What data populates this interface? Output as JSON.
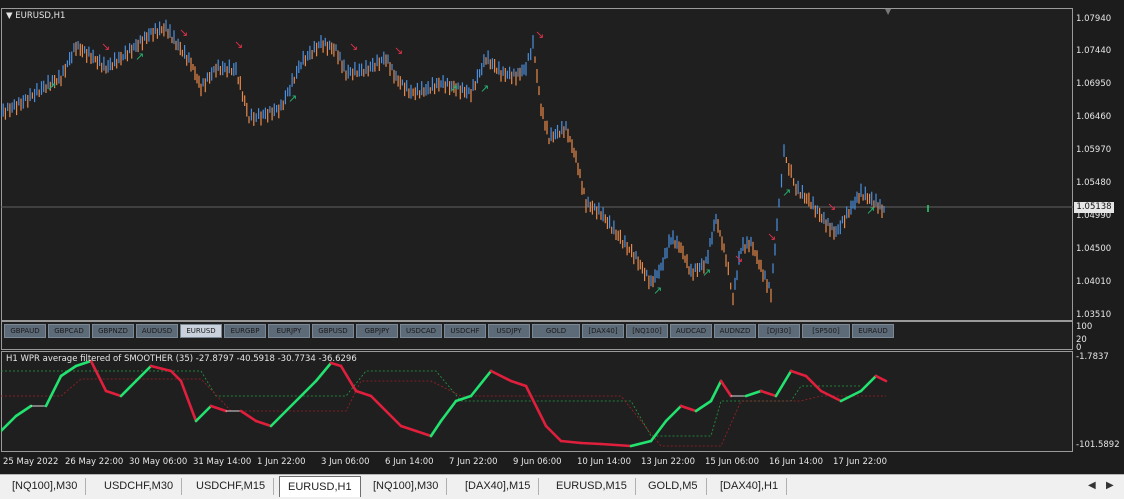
{
  "chart": {
    "title": "EURUSD,H1",
    "price_axis": [
      "1.07940",
      "1.07440",
      "1.06950",
      "1.06460",
      "1.05970",
      "1.05480",
      "1.04990",
      "1.04500",
      "1.04010",
      "1.03510"
    ],
    "current_price": "1.05138",
    "colors": {
      "bull": "#4a8fe0",
      "bear": "#e8894a",
      "arrow_up": "#26b070",
      "arrow_down": "#e0304a",
      "wpr_up": "#22e36f",
      "wpr_down": "#e01f3d"
    }
  },
  "symbols": [
    "GBPAUD",
    "GBPCAD",
    "GBPNZD",
    "AUDUSD",
    "EURUSD",
    "EURGBP",
    "EURJPY",
    "GBPUSD",
    "GBPJPY",
    "USDCAD",
    "USDCHF",
    "USDJPY",
    "GOLD",
    "[DAX40]",
    "[NQ100]",
    "AUDCAD",
    "AUDNZD",
    "[DJI30]",
    "[SP500]",
    "EURAUD"
  ],
  "symbol_scale": [
    "100",
    "20",
    "0"
  ],
  "indicator": {
    "title": "H1  WPR average filtered of SMOOTHER (35) -27.8797 -40.5918 -30.7734 -36.6296",
    "scale_top": "-1.7837",
    "scale_bottom": "-101.5892"
  },
  "time_axis": [
    "25 May 2022",
    "26 May 22:00",
    "30 May 06:00",
    "31 May 14:00",
    "1 Jun 22:00",
    "3 Jun 06:00",
    "6 Jun 14:00",
    "7 Jun 22:00",
    "9 Jun 06:00",
    "10 Jun 14:00",
    "13 Jun 22:00",
    "15 Jun 06:00",
    "16 Jun 14:00",
    "17 Jun 22:00"
  ],
  "tabs": [
    "[NQ100],M30",
    "USDCHF,M30",
    "USDCHF,M15",
    "EURUSD,H1",
    "[NQ100],M30",
    "[DAX40],M15",
    "EURUSD,M15",
    "GOLD,M5",
    "[DAX40],H1"
  ]
}
